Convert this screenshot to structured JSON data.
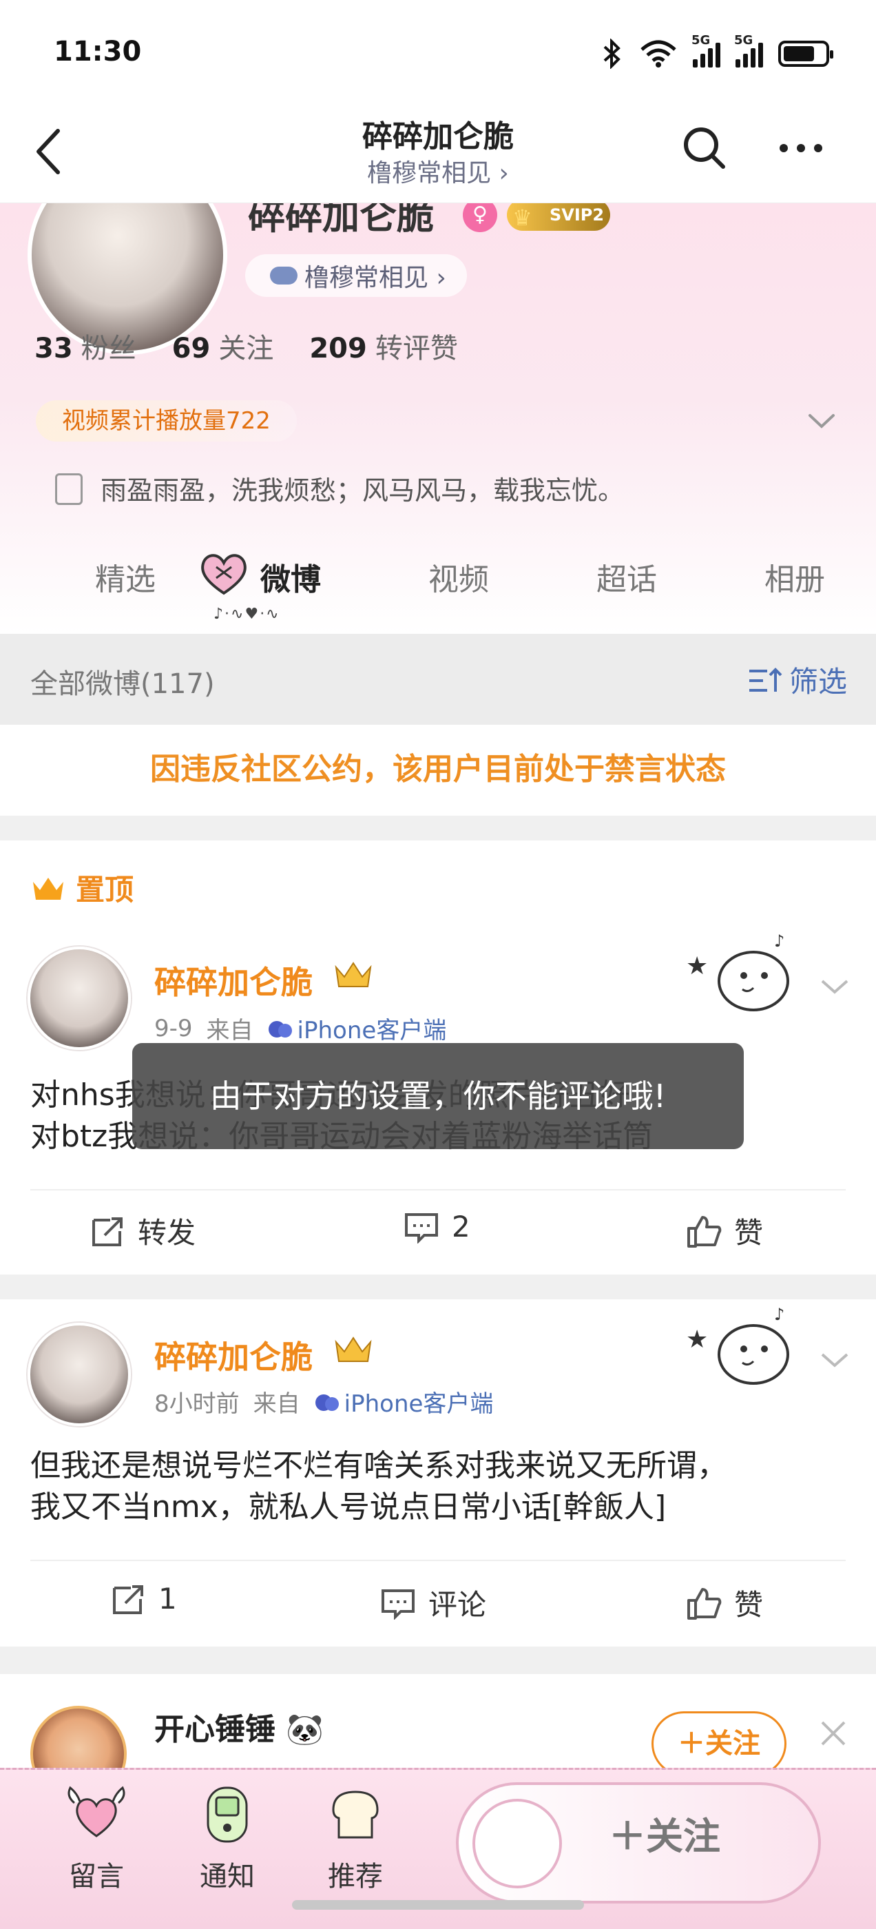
{
  "status_bar": {
    "time": "11:30",
    "net1": "5G",
    "net2": "5G"
  },
  "nav": {
    "title": "碎碎加仑脆",
    "subtitle": "橹穆常相见 ›"
  },
  "profile": {
    "name": "碎碎加仑脆",
    "vip": "SVIP2",
    "chip": "橹穆常相见 ›",
    "stats": [
      {
        "num": "33",
        "label": "粉丝"
      },
      {
        "num": "69",
        "label": "关注"
      },
      {
        "num": "209",
        "label": "转评赞"
      }
    ],
    "video_badge": "视频累计播放量722",
    "bio": "雨盈雨盈，洗我烦愁；风马风马，载我忘忧。"
  },
  "tabs": [
    {
      "label": "精选"
    },
    {
      "label": "微博"
    },
    {
      "label": "视频"
    },
    {
      "label": "超话"
    },
    {
      "label": "相册"
    }
  ],
  "filter": {
    "count": "全部微博(117)",
    "button": "筛选"
  },
  "ban_notice": "因违反社区公约，该用户目前处于禁言状态",
  "pinned_label": "置顶",
  "posts": [
    {
      "author": "碎碎加仑脆",
      "time": "9-9",
      "from": "来自",
      "source": "iPhone客户端",
      "text1": "对nhs我想说：你哥哥运动会发的照片好丑好",
      "text2": "对btz我想说：你哥哥运动会对着蓝粉海举话筒",
      "repost": "转发",
      "comment": "2",
      "like": "赞"
    },
    {
      "author": "碎碎加仑脆",
      "time": "8小时前",
      "from": "来自",
      "source": "iPhone客户端",
      "text1": "但我还是想说号烂不烂有啥关系对我来说又无所谓，",
      "text2": "我又不当nmx，就私人号说点日常小话[幹飯人]",
      "repost": "1",
      "comment": "评论",
      "like": "赞"
    }
  ],
  "toast": "由于对方的设置，你不能评论哦!",
  "recommend": {
    "name": "开心锤锤 🐼",
    "follow": "＋关注"
  },
  "bottom": {
    "items": [
      {
        "label": "留言"
      },
      {
        "label": "通知"
      },
      {
        "label": "推荐"
      }
    ],
    "follow": "＋关注"
  }
}
